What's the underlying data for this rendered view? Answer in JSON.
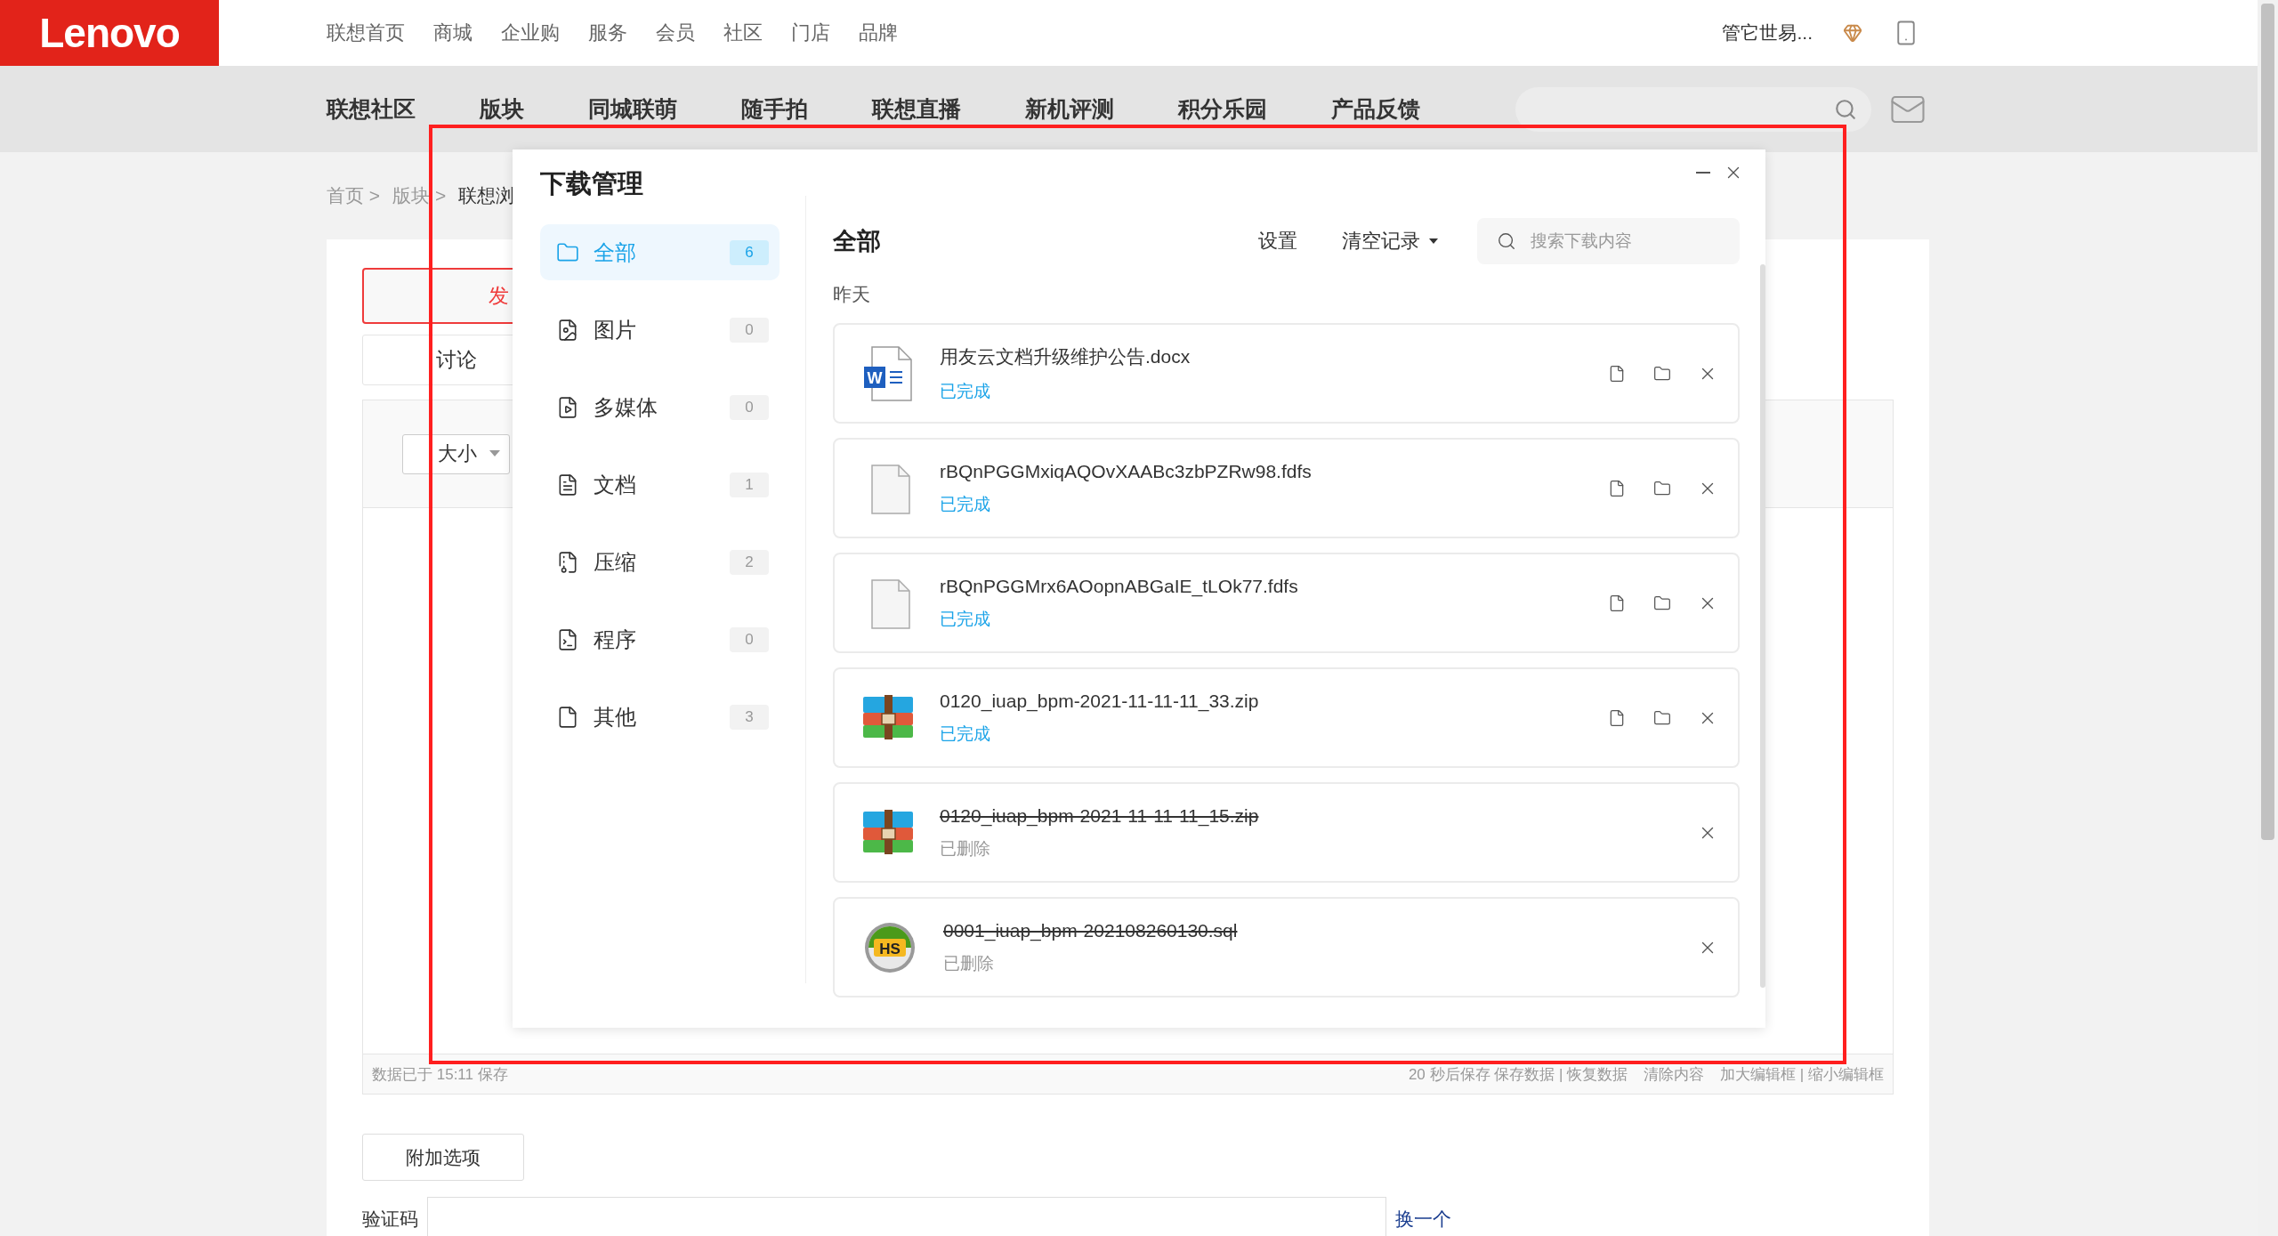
{
  "header": {
    "logo": "Lenovo",
    "links": [
      "联想首页",
      "商城",
      "企业购",
      "服务",
      "会员",
      "社区",
      "门店",
      "品牌"
    ],
    "user": "管它世易..."
  },
  "sub_nav": {
    "items": [
      "联想社区",
      "版块",
      "同城联萌",
      "随手拍",
      "联想直播",
      "新机评测",
      "积分乐园",
      "产品反馈"
    ]
  },
  "breadcrumb": [
    {
      "label": "首页 >",
      "current": false
    },
    {
      "label": "版块 >",
      "current": false
    },
    {
      "label": "联想浏",
      "current": true
    }
  ],
  "editor": {
    "post_button": "发",
    "type_option": "讨论",
    "size_select": "大小",
    "save_status": "数据已于 15:11 保存",
    "footer_links": [
      "20 秒后保存 保存数据 | 恢复数据",
      "清除内容",
      "加大编辑框 | 缩小编辑框"
    ]
  },
  "extra_options": "附加选项",
  "captcha": {
    "label": "验证码",
    "refresh": "换一个"
  },
  "dialog": {
    "title": "下载管理",
    "categories": [
      {
        "kind": "folder",
        "label": "全部",
        "count": "6",
        "selected": true
      },
      {
        "kind": "image",
        "label": "图片",
        "count": "0",
        "selected": false
      },
      {
        "kind": "media",
        "label": "多媒体",
        "count": "0",
        "selected": false
      },
      {
        "kind": "document",
        "label": "文档",
        "count": "1",
        "selected": false
      },
      {
        "kind": "archive",
        "label": "压缩",
        "count": "2",
        "selected": false
      },
      {
        "kind": "program",
        "label": "程序",
        "count": "0",
        "selected": false
      },
      {
        "kind": "other",
        "label": "其他",
        "count": "3",
        "selected": false
      }
    ],
    "heading": "全部",
    "settings": "设置",
    "clear": "清空记录",
    "search": {
      "placeholder": "搜索下载内容"
    },
    "group": "昨天",
    "downloads": [
      {
        "kind": "word",
        "icon_label": "W",
        "name": "用友云文档升级维护公告.docx",
        "status": "已完成",
        "deleted": false
      },
      {
        "kind": "blank",
        "name": "rBQnPGGMxiqAQOvXAABc3zbPZRw98.fdfs",
        "status": "已完成",
        "deleted": false
      },
      {
        "kind": "blank",
        "name": "rBQnPGGMrx6AOopnABGaIE_tLOk77.fdfs",
        "status": "已完成",
        "deleted": false
      },
      {
        "kind": "archive",
        "name": "0120_iuap_bpm-2021-11-11-11_33.zip",
        "status": "已完成",
        "deleted": false
      },
      {
        "kind": "archive",
        "name": "0120_iuap_bpm-2021-11-11-11_15.zip",
        "status": "已删除",
        "deleted": true
      },
      {
        "kind": "sql",
        "icon_label": "HS",
        "name": "0001_iuap_bpm-202108260130.sql",
        "status": "已删除",
        "deleted": true
      }
    ]
  }
}
